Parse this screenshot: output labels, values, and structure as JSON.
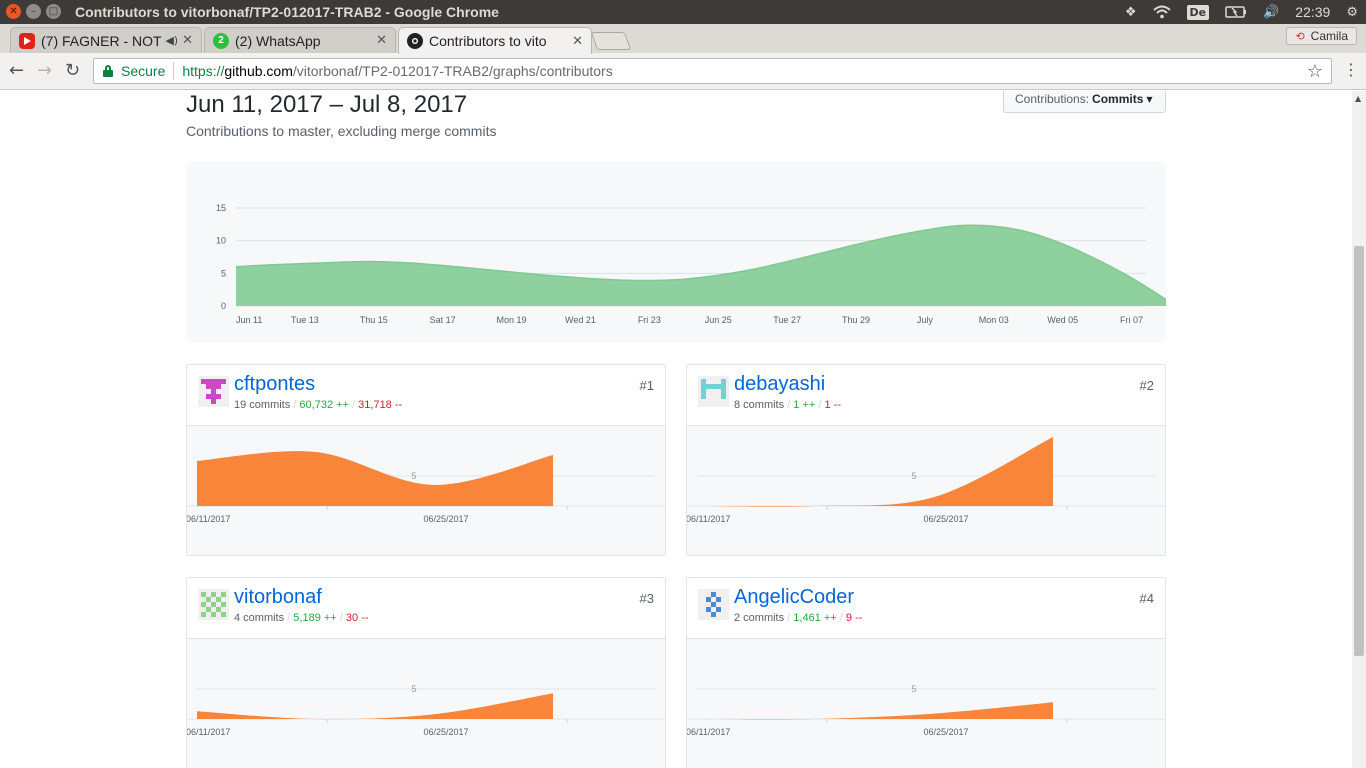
{
  "os": {
    "window_title": "Contributors to vitorbonaf/TP2-012017-TRAB2 - Google Chrome",
    "keyboard_layout": "De",
    "clock": "22:39"
  },
  "browser": {
    "tabs": [
      {
        "label": "(7) FAGNER - NOT",
        "favicon": "youtube-icon",
        "audio": true
      },
      {
        "label": "(2) WhatsApp",
        "favicon": "whatsapp-icon",
        "badge": "2"
      },
      {
        "label": "Contributors to vito",
        "favicon": "github-icon",
        "active": true
      }
    ],
    "profile_name": "Camila",
    "security_label": "Secure",
    "url_scheme": "https://",
    "url_host": "github.com",
    "url_path": "/vitorbonaf/TP2-012017-TRAB2/graphs/contributors"
  },
  "page": {
    "date_range": "Jun 11, 2017 – Jul 8, 2017",
    "subtitle": "Contributions to master, excluding merge commits",
    "contrib_select_label": "Contributions:",
    "contrib_select_value": "Commits"
  },
  "colors": {
    "main_fill": "#8fd19e",
    "main_stroke": "#7fc98f",
    "contributor_fill": "#f9853b",
    "link": "#0366d6",
    "additions": "#28a745",
    "deletions": "#cb2431"
  },
  "chart_data": [
    {
      "type": "area",
      "x": [
        "Jun 11",
        "Jun 12",
        "Jun 13",
        "Jun 14",
        "Jun 15",
        "Jun 16",
        "Jun 17",
        "Jun 18",
        "Jun 19",
        "Jun 20",
        "Jun 21",
        "Jun 22",
        "Jun 23",
        "Jun 24",
        "Jun 25",
        "Jun 26",
        "Jun 27",
        "Jun 28",
        "Jun 29",
        "Jun 30",
        "Jul 01",
        "Jul 02",
        "Jul 03",
        "Jul 04",
        "Jul 05",
        "Jul 06",
        "Jul 07",
        "Jul 08"
      ],
      "values": [
        6,
        6.3,
        6.5,
        6.7,
        6.8,
        6.6,
        6.2,
        5.7,
        5.2,
        4.7,
        4.3,
        4.0,
        3.9,
        4.1,
        4.7,
        5.6,
        6.8,
        8.1,
        9.4,
        10.6,
        11.6,
        12.3,
        12.2,
        11.3,
        9.5,
        7.1,
        4.3,
        1.0
      ],
      "ylim": [
        0,
        15
      ],
      "y_ticks": [
        "0",
        "5",
        "10",
        "15"
      ],
      "tick_labels": [
        {
          "label": "Jun 11",
          "index": 0
        },
        {
          "label": "Tue 13",
          "index": 2
        },
        {
          "label": "Thu 15",
          "index": 4
        },
        {
          "label": "Sat 17",
          "index": 6
        },
        {
          "label": "Mon 19",
          "index": 8
        },
        {
          "label": "Wed 21",
          "index": 10
        },
        {
          "label": "Fri 23",
          "index": 12
        },
        {
          "label": "Jun 25",
          "index": 14
        },
        {
          "label": "Tue 27",
          "index": 16
        },
        {
          "label": "Thu 29",
          "index": 18
        },
        {
          "label": "July",
          "index": 20
        },
        {
          "label": "Mon 03",
          "index": 22
        },
        {
          "label": "Wed 05",
          "index": 24
        },
        {
          "label": "Fri 07",
          "index": 26
        }
      ],
      "grid": true
    }
  ],
  "contributors": [
    {
      "rank": "#1",
      "name": "cftpontes",
      "commits": "19 commits",
      "additions": "60,732 ++",
      "deletions": "31,718 --",
      "avatar_color": "#c94bc4",
      "avatar_pattern": [
        "11111",
        "01110",
        "00100",
        "01110",
        "00100"
      ],
      "weekly": [
        7.5,
        9.0,
        3.5,
        8.5
      ],
      "x_labels": [
        "06/11/2017",
        "06/25/2017"
      ],
      "y_tick": "5"
    },
    {
      "rank": "#2",
      "name": "debayashi",
      "commits": "8 commits",
      "additions": "1 ++",
      "deletions": "1 --",
      "avatar_color": "#6fd3d6",
      "avatar_pattern": [
        "10001",
        "11111",
        "10001",
        "10001",
        "00000"
      ],
      "weekly": [
        0,
        0,
        1.5,
        11.5
      ],
      "x_labels": [
        "06/11/2017",
        "06/25/2017"
      ],
      "y_tick": "5"
    },
    {
      "rank": "#3",
      "name": "vitorbonaf",
      "commits": "4 commits",
      "additions": "5,189 ++",
      "deletions": "30 --",
      "avatar_color": "#8fd18a",
      "avatar_pattern": [
        "10101",
        "01010",
        "10101",
        "01010",
        "10101"
      ],
      "weekly": [
        1.3,
        0,
        0.8,
        4.3
      ],
      "x_labels": [
        "06/11/2017",
        "06/25/2017"
      ],
      "y_tick": "5"
    },
    {
      "rank": "#4",
      "name": "AngelicCoder",
      "commits": "2 commits",
      "additions": "1,461 ++",
      "deletions": "9 --",
      "avatar_color": "#4a88d9",
      "avatar_pattern": [
        "00100",
        "01010",
        "00100",
        "01010",
        "00100"
      ],
      "weekly": [
        0,
        0,
        0.9,
        2.8
      ],
      "x_labels": [
        "06/11/2017",
        "06/25/2017"
      ],
      "y_tick": "5"
    }
  ]
}
